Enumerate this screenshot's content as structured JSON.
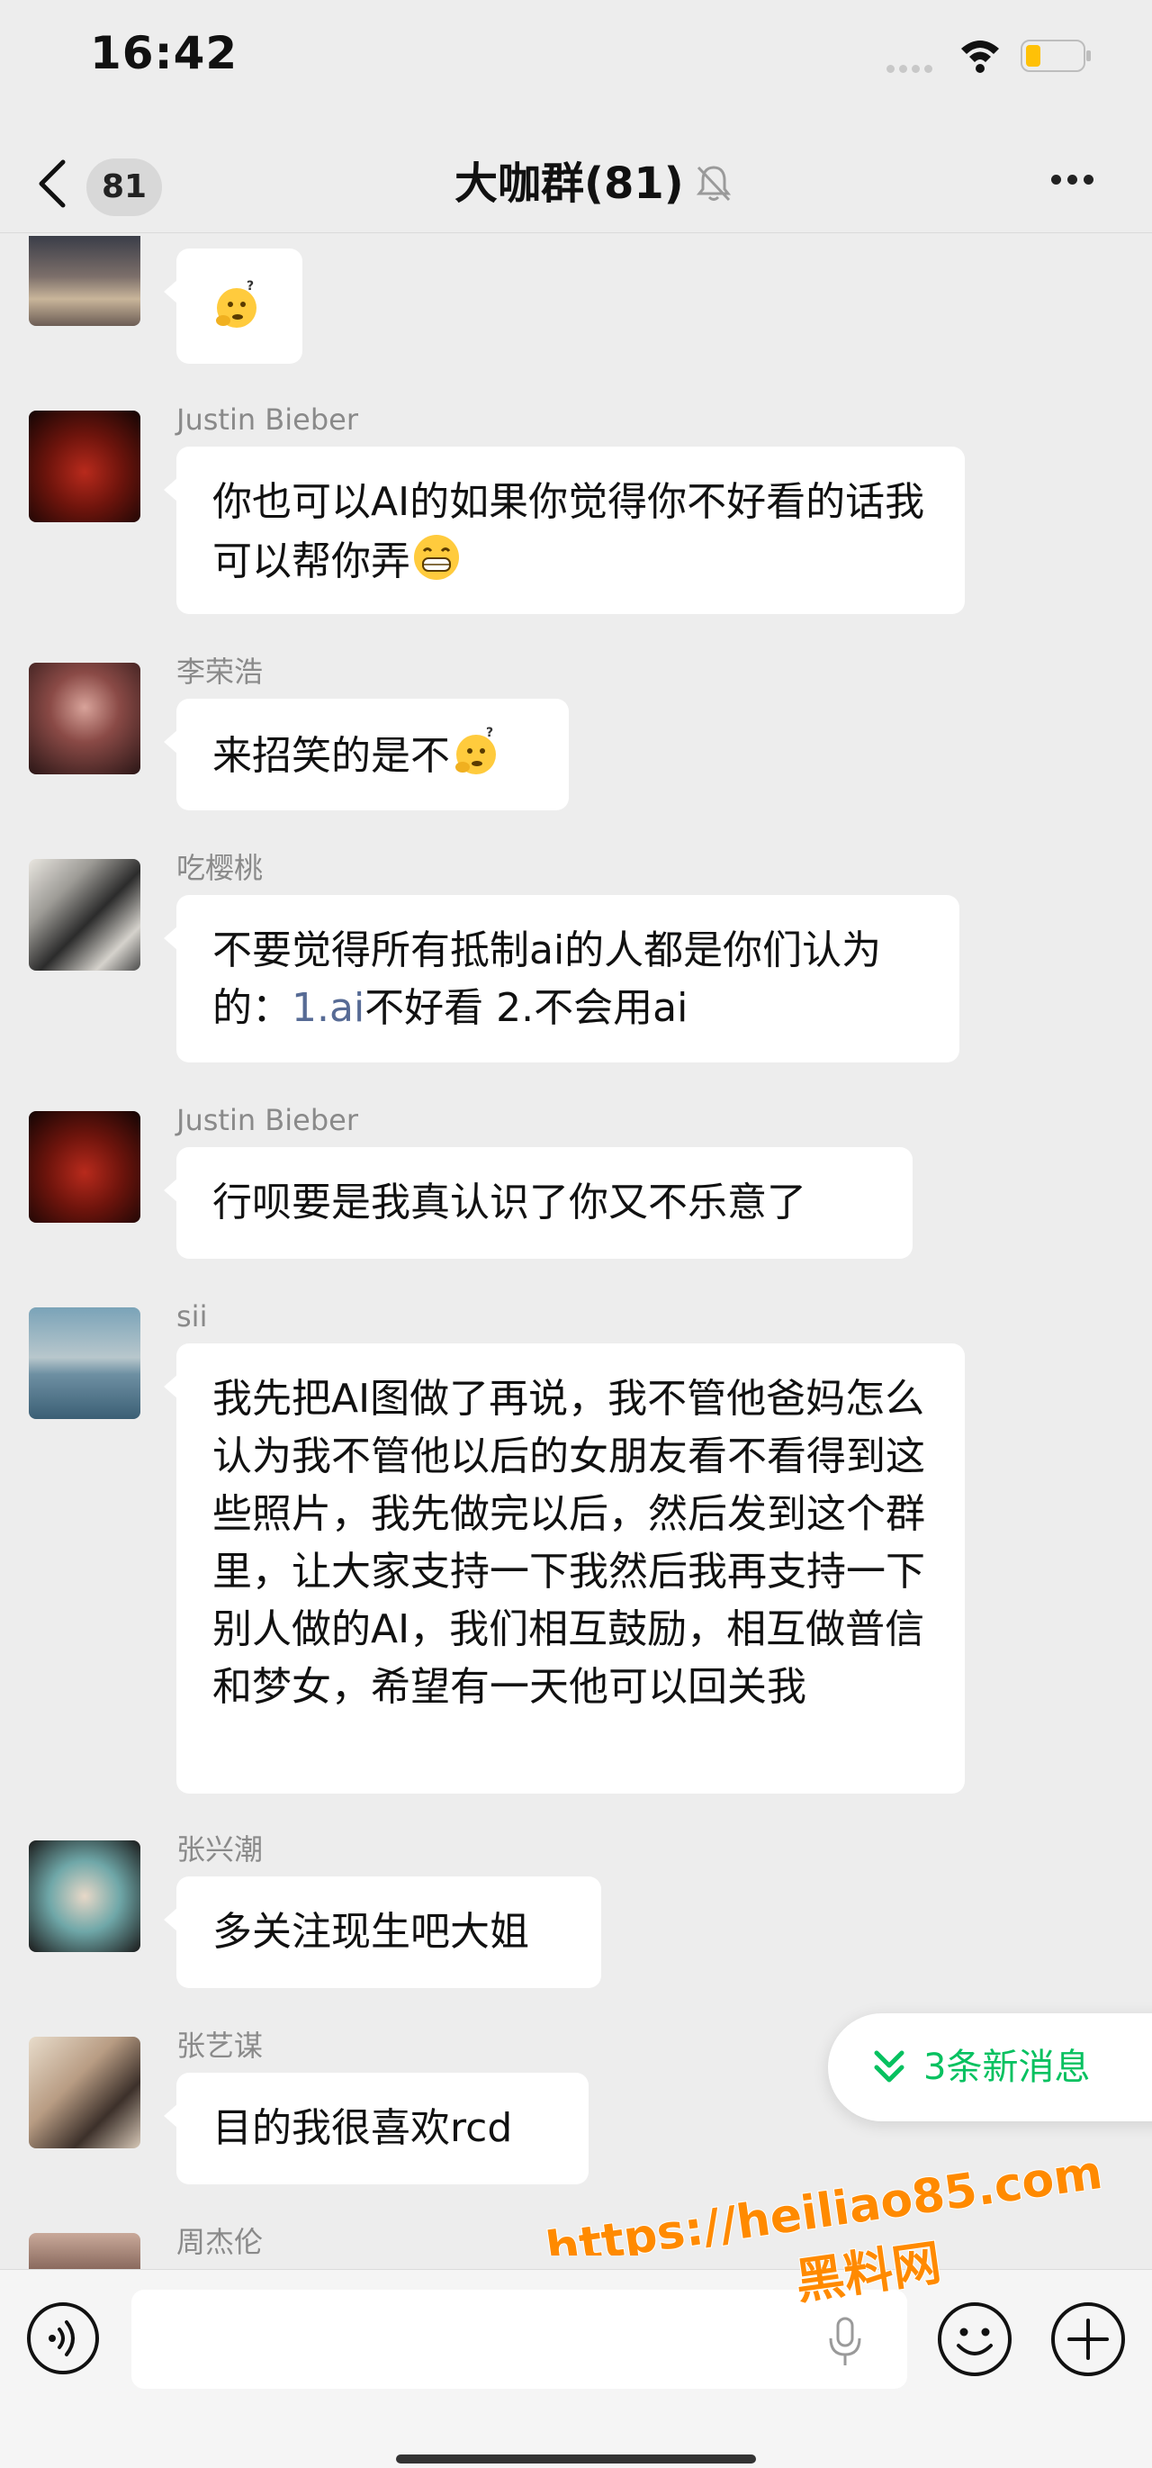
{
  "status_bar": {
    "time": "16:42"
  },
  "nav": {
    "back_count": "81",
    "title": "大咖群(81)"
  },
  "messages": [
    {
      "sender": "",
      "text": ""
    },
    {
      "sender": "Justin Bieber",
      "text": "你也可以AI的如果你觉得你不好看的话我可以帮你弄"
    },
    {
      "sender": "李荣浩",
      "text": "来招笑的是不"
    },
    {
      "sender": "吃樱桃",
      "text_before": "不要觉得所有抵制ai的人都是你们认为的：",
      "link": "1.ai",
      "text_after": "不好看 2.不会用ai"
    },
    {
      "sender": "Justin Bieber",
      "text": "行呗要是我真认识了你又不乐意了"
    },
    {
      "sender": "sii",
      "text": "我先把AI图做了再说，我不管他爸妈怎么认为我不管他以后的女朋友看不看得到这些照片，我先做完以后，然后发到这个群里，让大家支持一下我然后我再支持一下别人做的AI，我们相互鼓励，相互做普信和梦女，希望有一天他可以回关我"
    },
    {
      "sender": "张兴潮",
      "text": "多关注现生吧大姐"
    },
    {
      "sender": "张艺谋",
      "text": "目的我很喜欢rcd"
    },
    {
      "sender": "周杰伦",
      "text": ""
    }
  ],
  "new_messages": {
    "label": "3条新消息"
  },
  "watermark": {
    "line1": "https://heiliao85.com",
    "line2": "黑料网"
  },
  "colors": {
    "background": "#ededed",
    "bubble": "#ffffff",
    "link": "#576b95",
    "accent": "#07c160",
    "watermark": "#ff8a00"
  },
  "icons": [
    "back-chevron-icon",
    "mute-bell-icon",
    "more-icon",
    "thinking-emoji-icon",
    "grinning-emoji-icon",
    "voice-icon",
    "mic-icon",
    "emoji-icon",
    "plus-icon",
    "double-chevron-down-icon",
    "wifi-icon",
    "battery-icon"
  ]
}
